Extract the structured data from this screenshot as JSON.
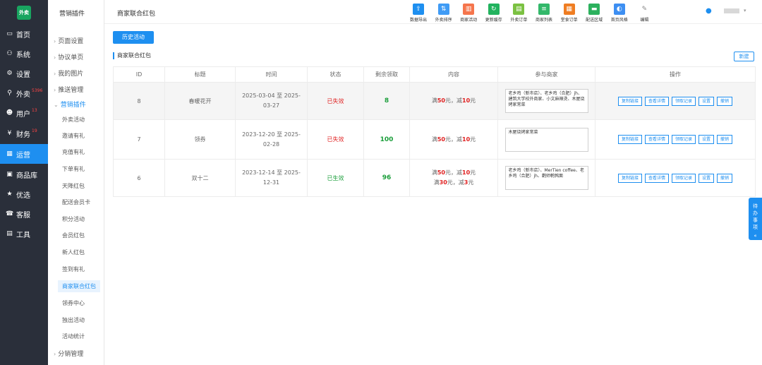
{
  "app": {
    "logo_text": "外卖"
  },
  "nav": [
    {
      "label": "首页",
      "icon": "monitor-icon",
      "glyph": "▭"
    },
    {
      "label": "系统",
      "icon": "sitemap-icon",
      "glyph": "⚇"
    },
    {
      "label": "设置",
      "icon": "gear-icon",
      "glyph": "⚙"
    },
    {
      "label": "外卖",
      "icon": "bike-icon",
      "glyph": "⚲",
      "badge": "5396"
    },
    {
      "label": "用户",
      "icon": "user-icon",
      "glyph": "☻",
      "badge": "13"
    },
    {
      "label": "财务",
      "icon": "coin-icon",
      "glyph": "¥",
      "badge": "19"
    },
    {
      "label": "运营",
      "icon": "chart-icon",
      "glyph": "▦"
    },
    {
      "label": "商品库",
      "icon": "box-icon",
      "glyph": "▣"
    },
    {
      "label": "优选",
      "icon": "star-icon",
      "glyph": "★"
    },
    {
      "label": "客服",
      "icon": "headset-icon",
      "glyph": "☎"
    },
    {
      "label": "工具",
      "icon": "briefcase-icon",
      "glyph": "▤"
    }
  ],
  "subnav": {
    "header": "营销插件",
    "groups": [
      "页面设置",
      "协议单页",
      "我的图片",
      "推送管理"
    ],
    "open_group": "营销插件",
    "children": [
      "外卖活动",
      "邀请有礼",
      "充值有礼",
      "下单有礼",
      "天降红包",
      "配送会员卡",
      "积分活动",
      "会员红包",
      "新人红包",
      "签到有礼",
      "商家联合红包",
      "领券中心",
      "独出活动",
      "活动统计"
    ],
    "last_group": "分销管理"
  },
  "topbar": {
    "breadcrumb": "商家联合红包",
    "tools": [
      {
        "label": "数据导出",
        "icon": "upload-icon",
        "glyph": "⇧",
        "color": "#1e8ff0"
      },
      {
        "label": "外卖排序",
        "icon": "sort-icon",
        "glyph": "⇅",
        "color": "#3f9bf5"
      },
      {
        "label": "商家活动",
        "icon": "gift-icon",
        "glyph": "▥",
        "color": "#f5754c"
      },
      {
        "label": "更新缓存",
        "icon": "refresh-icon",
        "glyph": "↻",
        "color": "#22b35e"
      },
      {
        "label": "外卖订单",
        "icon": "clipboard-icon",
        "glyph": "▤",
        "color": "#7bc142"
      },
      {
        "label": "商家列表",
        "icon": "list-icon",
        "glyph": "≡",
        "color": "#33b86a"
      },
      {
        "label": "堂食订单",
        "icon": "receipt-icon",
        "glyph": "▦",
        "color": "#ef7d22"
      },
      {
        "label": "配送区域",
        "icon": "truck-icon",
        "glyph": "▬",
        "color": "#2cb15d"
      },
      {
        "label": "首页风格",
        "icon": "palette-icon",
        "glyph": "◐",
        "color": "#3d8ff2"
      },
      {
        "label": "编辑",
        "icon": "pencil-icon",
        "glyph": "✎",
        "color": "#dcdcdc"
      }
    ]
  },
  "content": {
    "history_button": "历史活动",
    "section_title": "商家联合红包",
    "new_button": "新建",
    "columns": [
      "ID",
      "标题",
      "时间",
      "状态",
      "剩余领取",
      "内容",
      "参与商家",
      "操作"
    ],
    "rows": [
      {
        "id": "8",
        "title": "春暖花开",
        "time": "2025-03-04 至 2025-03-27",
        "status": "已失效",
        "status_type": "expired",
        "remain": "8",
        "content": [
          {
            "pre": "满",
            "a": "50",
            "mid": "元，减",
            "b": "10",
            "post": "元"
          }
        ],
        "merchants": "老乡鸡（新市店）、老乡鸡（合肥）jh、建筑大学校外商家、小文麻辣烫、木屋烧烤家常菜"
      },
      {
        "id": "7",
        "title": "领券",
        "time": "2023-12-20 至 2025-02-28",
        "status": "已失效",
        "status_type": "expired",
        "remain": "100",
        "content": [
          {
            "pre": "满",
            "a": "50",
            "mid": "元，减",
            "b": "10",
            "post": "元"
          }
        ],
        "merchants": "木屋烧烤家常菜"
      },
      {
        "id": "6",
        "title": "双十二",
        "time": "2023-12-14 至 2025-12-31",
        "status": "已生效",
        "status_type": "active",
        "remain": "96",
        "content": [
          {
            "pre": "满",
            "a": "50",
            "mid": "元，减",
            "b": "10",
            "post": "元"
          },
          {
            "pre": "满",
            "a": "30",
            "mid": "元，减",
            "b": "3",
            "post": "元"
          }
        ],
        "merchants": "老乡鸡（新市店）、MerTien coffee、老乡鸡（合肥）jh、鹳师鹌鹑面"
      }
    ],
    "actions": [
      "复制链接",
      "查看详情",
      "领取记录",
      "设置",
      "撤销"
    ]
  },
  "todo_tab": {
    "label": "待办事项",
    "arrow": "«"
  }
}
